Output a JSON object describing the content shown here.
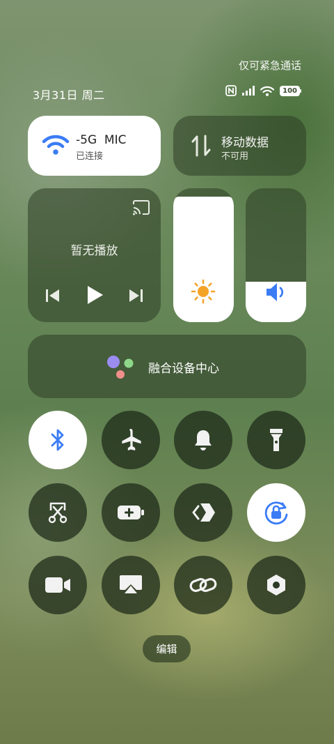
{
  "status_bar": {
    "emergency_text": "仅可紧急通话",
    "date_text": "3月31日 周二",
    "battery_level": "100"
  },
  "wifi_tile": {
    "title": "-5G  MIC",
    "subtitle": "已连接",
    "active": true,
    "accent": "#3b7cf5"
  },
  "mobile_tile": {
    "title": "移动数据",
    "subtitle": "不可用",
    "active": false
  },
  "media_tile": {
    "label": "暂无播放"
  },
  "brightness": {
    "level": 0.94,
    "icon_color": "#f4a329"
  },
  "volume": {
    "level": 0.3,
    "icon_color": "#3b7cf5"
  },
  "fusion": {
    "label": "融合设备中心"
  },
  "toggles": [
    {
      "icon": "bluetooth-icon",
      "on": true
    },
    {
      "icon": "airplane-icon",
      "on": false
    },
    {
      "icon": "bell-icon",
      "on": false
    },
    {
      "icon": "flashlight-icon",
      "on": false
    },
    {
      "icon": "screenshot-scissors-icon",
      "on": false
    },
    {
      "icon": "battery-saver-icon",
      "on": false
    },
    {
      "icon": "share-code-icon",
      "on": false
    },
    {
      "icon": "rotation-lock-icon",
      "on": true
    },
    {
      "icon": "video-camera-icon",
      "on": false
    },
    {
      "icon": "screen-cast-icon",
      "on": false
    },
    {
      "icon": "link-icon",
      "on": false
    },
    {
      "icon": "settings-hex-icon",
      "on": false
    }
  ],
  "edit_label": "编辑"
}
